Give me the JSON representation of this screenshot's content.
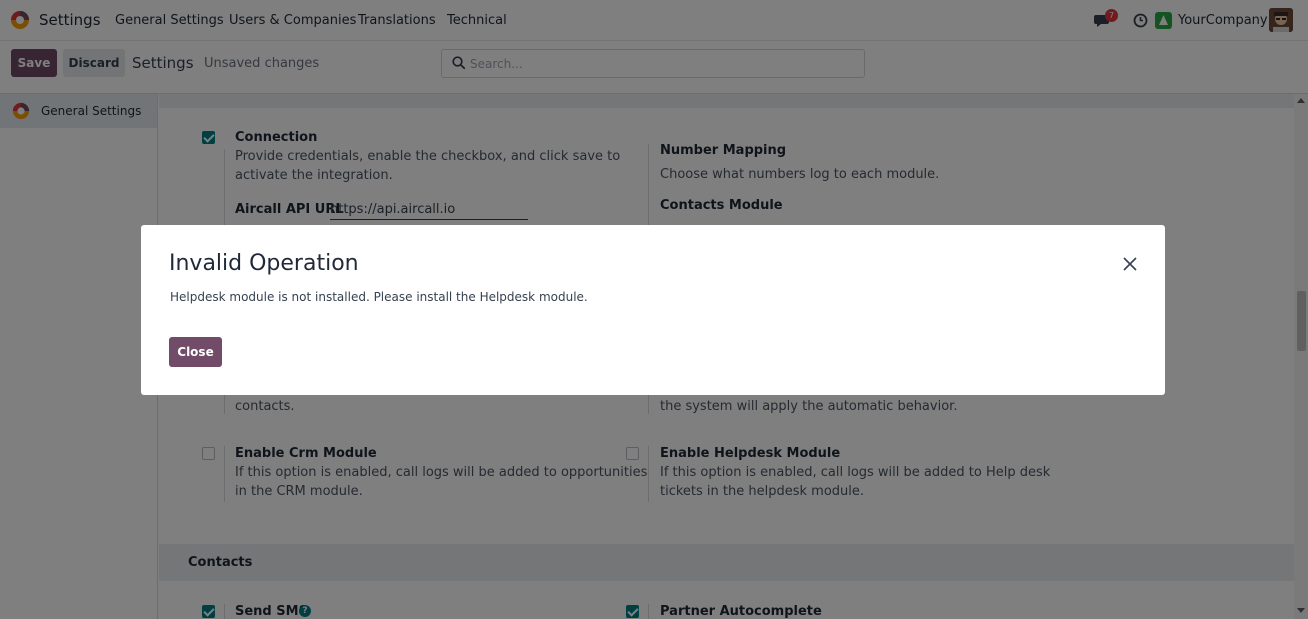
{
  "navbar": {
    "app_name": "Settings",
    "menu": [
      "General Settings",
      "Users & Companies",
      "Translations",
      "Technical"
    ],
    "message_count": "7",
    "company": "YourCompany"
  },
  "control_panel": {
    "save_label": "Save",
    "discard_label": "Discard",
    "title": "Settings",
    "status": "Unsaved changes",
    "search_placeholder": "Search..."
  },
  "sidebar": {
    "items": [
      {
        "label": "General Settings"
      }
    ]
  },
  "content": {
    "connection": {
      "title": "Connection",
      "desc_line1": "Provide credentials, enable the checkbox, and click save to",
      "desc_line2": "activate the integration.",
      "checked": true,
      "url_label": "Aircall API URL",
      "url_value": "https://api.aircall.io"
    },
    "number_mapping": {
      "title": "Number Mapping",
      "desc": "Choose what numbers log to each module.",
      "contacts_module": "Contacts Module"
    },
    "partial_left": "contacts.",
    "partial_right": "the system will apply the automatic behavior.",
    "crm": {
      "title": "Enable Crm Module",
      "desc_line1": "If this option is enabled, call logs will be added to opportunities",
      "desc_line2": "in the CRM module.",
      "checked": false
    },
    "helpdesk": {
      "title": "Enable Helpdesk Module",
      "desc_line1": "If this option is enabled, call logs will be added to Help desk",
      "desc_line2": "tickets in the helpdesk module.",
      "checked": false
    },
    "contacts_section": "Contacts",
    "send_sms": {
      "title": "Send SMS",
      "checked": true
    },
    "partner_autocomplete": {
      "title": "Partner Autocomplete",
      "checked": true
    }
  },
  "modal": {
    "title": "Invalid Operation",
    "message": "Helpdesk module is not installed. Please install the Helpdesk module.",
    "close_label": "Close"
  },
  "colors": {
    "primary": "#714b67",
    "checkbox": "#017e84",
    "badge": "#e0393e"
  }
}
